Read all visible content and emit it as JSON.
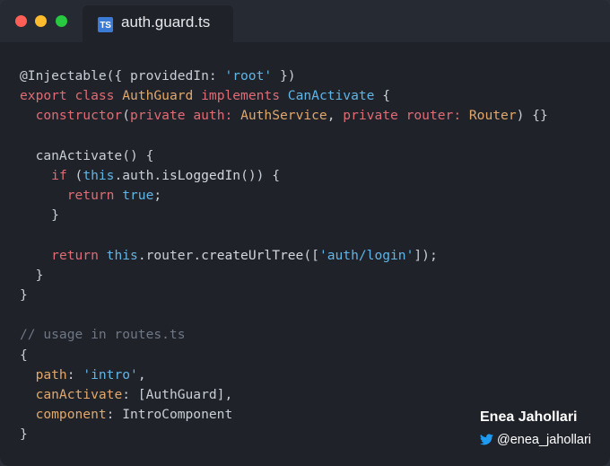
{
  "window": {
    "tab_title": "auth.guard.ts",
    "tab_icon_label": "TS",
    "icons": [
      "close-dot",
      "minimize-dot",
      "maximize-dot",
      "typescript-file-icon"
    ],
    "colors": {
      "background": "#1f2229",
      "keyword": "#e06c75",
      "type": "#e2a86b",
      "string": "#61b5e6",
      "comment": "#6f7785"
    }
  },
  "code": {
    "t01": "@Injectable({ providedIn: ",
    "t02": "'root'",
    "t03": " })",
    "t04": "export",
    "t05": " ",
    "t06": "class",
    "t07": " ",
    "t08": "AuthGuard",
    "t09": " ",
    "t10": "implements",
    "t11": " ",
    "t12": "CanActivate",
    "t13": " {",
    "t14": "  constructor",
    "t15": "(",
    "t16": "private",
    "t17": " auth: ",
    "t18": "AuthService",
    "t19": ", ",
    "t20": "private",
    "t21": " router: ",
    "t22": "Router",
    "t23": ") {}",
    "t24": "  canActivate() {",
    "t25": "    ",
    "t26": "if",
    "t27": " (",
    "t28": "this",
    "t29": ".auth.",
    "t30": "isLoggedIn",
    "t31": "()) {",
    "t32": "      ",
    "t33": "return",
    "t34": " ",
    "t35": "true",
    "t36": ";",
    "t37": "    }",
    "t38": "    ",
    "t39": "return",
    "t40": " ",
    "t41": "this",
    "t42": ".router.",
    "t43": "createUrlTree",
    "t44": "([",
    "t45": "'auth/login'",
    "t46": "]);",
    "t47": "  }",
    "t48": "}",
    "t49": "// usage in routes.ts",
    "t50": "{",
    "t51": "  ",
    "t52": "path",
    "t53": ": ",
    "t54": "'intro'",
    "t55": ",",
    "t56": "  ",
    "t57": "canActivate",
    "t58": ": [AuthGuard],",
    "t59": "  ",
    "t60": "component",
    "t61": ": IntroComponent",
    "t62": "}"
  },
  "author": {
    "name": "Enea Jahollari",
    "handle": "@enea_jahollari",
    "icon": "twitter-bird-icon"
  }
}
